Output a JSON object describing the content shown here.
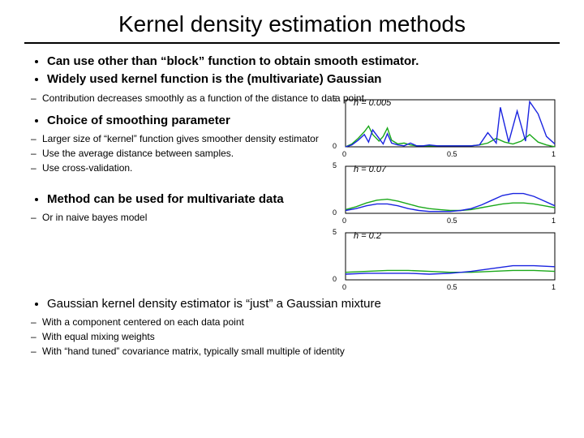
{
  "title": "Kernel density estimation methods",
  "bullets": {
    "b1": "Can use other than “block” function to obtain smooth estimator.",
    "b2": "Widely used kernel function is the (multivariate) Gaussian",
    "b2_sub1": "Contribution decreases smoothly as a function of the distance to data point.",
    "b3": "Choice of smoothing parameter",
    "b3_sub1": "Larger size of “kernel” function gives smoother density estimator",
    "b3_sub2": "Use the average distance between samples.",
    "b3_sub3": "Use cross-validation.",
    "b4": "Method can be used for multivariate data",
    "b4_sub1": "Or in naive bayes model",
    "b5": "Gaussian kernel density estimator is “just” a Gaussian mixture",
    "b5_sub1": "With a component centered on each data point",
    "b5_sub2": "With equal mixing weights",
    "b5_sub3": "With “hand tuned” covariance matrix, typically small multiple of identity"
  },
  "chart_data": [
    {
      "type": "line",
      "title": "h = 0.005",
      "xlabel": "",
      "ylabel": "",
      "xlim": [
        0,
        1
      ],
      "ylim": [
        0,
        5
      ],
      "xticks": [
        0,
        0.5,
        1
      ],
      "yticks": [
        0,
        5
      ],
      "series": [
        {
          "name": "estimate-green",
          "color": "#1aa81a",
          "x": [
            0.0,
            0.03,
            0.06,
            0.09,
            0.11,
            0.13,
            0.16,
            0.18,
            0.2,
            0.22,
            0.25,
            0.28,
            0.31,
            0.34,
            0.37,
            0.4,
            0.44,
            0.48,
            0.52,
            0.56,
            0.6,
            0.64,
            0.68,
            0.72,
            0.76,
            0.8,
            0.84,
            0.88,
            0.92,
            0.96,
            1.0
          ],
          "values": [
            0.0,
            0.3,
            0.9,
            1.6,
            2.2,
            1.3,
            0.6,
            1.1,
            2.0,
            0.7,
            0.3,
            0.4,
            0.2,
            0.1,
            0.1,
            0.1,
            0.1,
            0.1,
            0.1,
            0.1,
            0.1,
            0.2,
            0.4,
            0.9,
            0.5,
            0.3,
            0.6,
            1.3,
            0.5,
            0.2,
            0.0
          ]
        },
        {
          "name": "estimate-blue",
          "color": "#1a24e0",
          "x": [
            0.0,
            0.03,
            0.06,
            0.09,
            0.11,
            0.13,
            0.16,
            0.18,
            0.2,
            0.22,
            0.25,
            0.28,
            0.31,
            0.34,
            0.37,
            0.4,
            0.44,
            0.48,
            0.52,
            0.56,
            0.6,
            0.64,
            0.68,
            0.72,
            0.74,
            0.78,
            0.82,
            0.86,
            0.88,
            0.92,
            0.96,
            1.0
          ],
          "values": [
            0.0,
            0.2,
            0.7,
            1.3,
            0.5,
            1.8,
            0.9,
            0.3,
            1.4,
            0.4,
            0.2,
            0.1,
            0.4,
            0.1,
            0.1,
            0.2,
            0.1,
            0.1,
            0.1,
            0.1,
            0.1,
            0.2,
            1.5,
            0.4,
            4.2,
            0.5,
            3.8,
            0.6,
            4.8,
            3.5,
            1.1,
            0.3
          ]
        }
      ]
    },
    {
      "type": "line",
      "title": "h = 0.07",
      "xlabel": "",
      "ylabel": "",
      "xlim": [
        0,
        1
      ],
      "ylim": [
        0,
        5
      ],
      "xticks": [
        0,
        0.5,
        1
      ],
      "yticks": [
        0,
        5
      ],
      "series": [
        {
          "name": "estimate-green",
          "color": "#1aa81a",
          "x": [
            0.0,
            0.05,
            0.1,
            0.15,
            0.2,
            0.25,
            0.3,
            0.35,
            0.4,
            0.45,
            0.5,
            0.55,
            0.6,
            0.65,
            0.7,
            0.75,
            0.8,
            0.85,
            0.9,
            0.95,
            1.0
          ],
          "values": [
            0.4,
            0.7,
            1.1,
            1.4,
            1.5,
            1.3,
            1.0,
            0.7,
            0.5,
            0.4,
            0.3,
            0.3,
            0.4,
            0.6,
            0.8,
            1.0,
            1.1,
            1.1,
            1.0,
            0.8,
            0.6
          ]
        },
        {
          "name": "estimate-blue",
          "color": "#1a24e0",
          "x": [
            0.0,
            0.05,
            0.1,
            0.15,
            0.2,
            0.25,
            0.3,
            0.35,
            0.4,
            0.45,
            0.5,
            0.55,
            0.6,
            0.65,
            0.7,
            0.75,
            0.8,
            0.85,
            0.9,
            0.95,
            1.0
          ],
          "values": [
            0.3,
            0.5,
            0.8,
            1.0,
            1.0,
            0.8,
            0.5,
            0.3,
            0.2,
            0.2,
            0.2,
            0.3,
            0.5,
            0.9,
            1.4,
            1.9,
            2.1,
            2.1,
            1.8,
            1.3,
            0.8
          ]
        }
      ]
    },
    {
      "type": "line",
      "title": "h = 0.2",
      "xlabel": "",
      "ylabel": "",
      "xlim": [
        0,
        1
      ],
      "ylim": [
        0,
        5
      ],
      "xticks": [
        0,
        0.5,
        1
      ],
      "yticks": [
        0,
        5
      ],
      "series": [
        {
          "name": "estimate-green",
          "color": "#1aa81a",
          "x": [
            0.0,
            0.1,
            0.2,
            0.3,
            0.4,
            0.5,
            0.6,
            0.7,
            0.8,
            0.9,
            1.0
          ],
          "values": [
            0.8,
            0.9,
            1.0,
            1.0,
            0.9,
            0.8,
            0.8,
            0.9,
            1.0,
            1.0,
            0.9
          ]
        },
        {
          "name": "estimate-blue",
          "color": "#1a24e0",
          "x": [
            0.0,
            0.1,
            0.2,
            0.3,
            0.4,
            0.5,
            0.6,
            0.7,
            0.8,
            0.9,
            1.0
          ],
          "values": [
            0.6,
            0.7,
            0.7,
            0.7,
            0.6,
            0.7,
            0.9,
            1.2,
            1.5,
            1.5,
            1.4
          ]
        }
      ]
    }
  ],
  "chart_colors": {
    "axis": "#000000",
    "grid": "#f0f0f0"
  }
}
